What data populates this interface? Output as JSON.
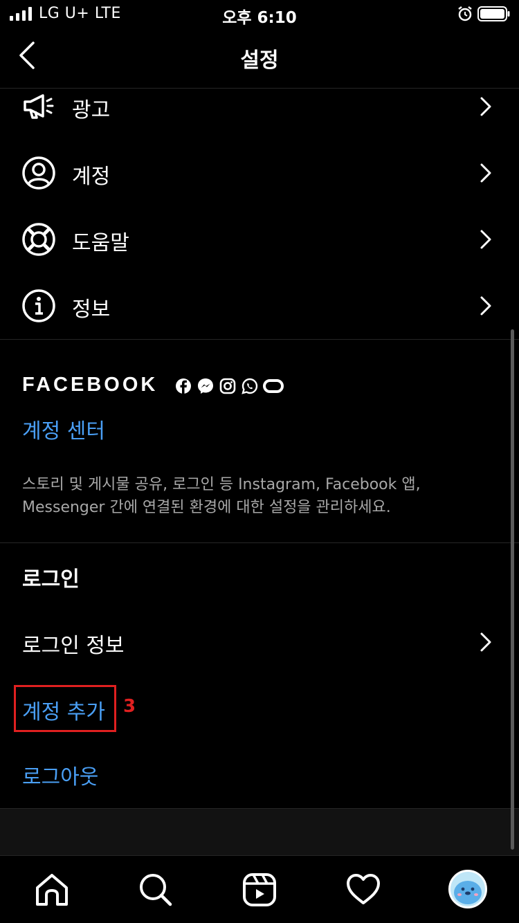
{
  "status_bar": {
    "carrier": "LG U+  LTE",
    "time": "오후 6:10"
  },
  "header": {
    "title": "설정"
  },
  "menu": [
    {
      "label": "광고",
      "icon": "megaphone-icon"
    },
    {
      "label": "계정",
      "icon": "person-circle-icon"
    },
    {
      "label": "도움말",
      "icon": "lifebuoy-icon"
    },
    {
      "label": "정보",
      "icon": "info-icon"
    }
  ],
  "facebook": {
    "brand": "FACEBOOK",
    "brand_icons": [
      "facebook-icon",
      "messenger-icon",
      "instagram-icon",
      "whatsapp-icon",
      "oculus-icon"
    ],
    "accounts_center": "계정 센터",
    "description": "스토리 및 게시물 공유, 로그인 등 Instagram, Facebook 앱, Messenger 간에 연결된 환경에 대한 설정을 관리하세요."
  },
  "login": {
    "title": "로그인",
    "login_info": "로그인 정보",
    "add_account": "계정 추가",
    "step_badge": "3",
    "logout": "로그아웃"
  },
  "tab_bar": [
    "home-icon",
    "search-icon",
    "reels-icon",
    "heart-icon",
    "profile-avatar"
  ],
  "colors": {
    "background": "#000000",
    "link_blue": "#4a9ff5",
    "highlight_red": "#e02020",
    "secondary_text": "#a8a8a8",
    "divider": "#262626"
  }
}
